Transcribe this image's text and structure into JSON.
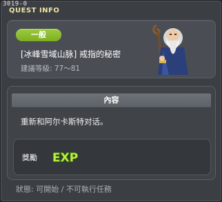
{
  "window": {
    "quest_id": "3019-0",
    "title": "QUEST INFO"
  },
  "quest": {
    "category_badge": "一般",
    "name": "[冰峰雪域山脉] 戒指的秘密",
    "level_label": "建議等級",
    "level_range": "77～81",
    "level_text": "建議等級: 77～81",
    "npc_icon": "old-wizard-npc-portrait"
  },
  "content": {
    "header": "內容",
    "text": "重新和阿尔卡斯特对话。"
  },
  "reward": {
    "label": "獎勵",
    "exp_icon": "exp-icon",
    "exp_text": "EXP"
  },
  "status": {
    "text": "狀態: 可開始 / 不可執行任務"
  },
  "colors": {
    "title": "#f3e4a4",
    "badge": "#8fbf2f",
    "exp_green": "#b7f03a"
  }
}
